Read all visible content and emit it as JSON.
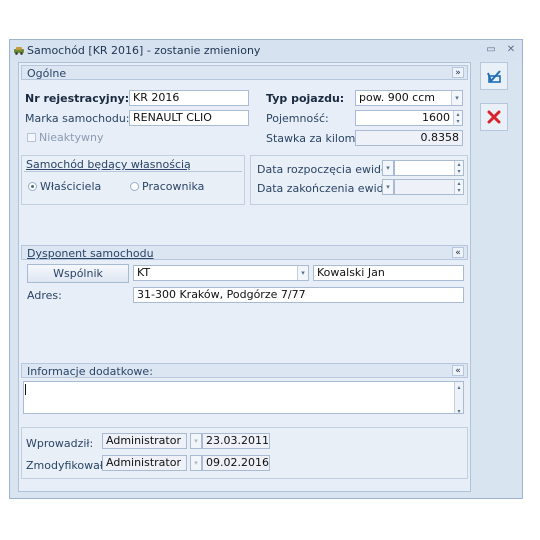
{
  "window": {
    "title": "Samochód [KR 2016] - zostanie zmieniony"
  },
  "general": {
    "section_title": "Ogólne",
    "reg_label": "Nr rejestracyjny:",
    "reg_value": "KR 2016",
    "brand_label": "Marka samochodu:",
    "brand_value": "RENAULT CLIO",
    "inactive_label": "Nieaktywny",
    "type_label": "Typ pojazdu:",
    "type_value": "pow. 900 ccm",
    "capacity_label": "Pojemność:",
    "capacity_value": "1600",
    "rate_label": "Stawka za kilometr:",
    "rate_value": "0.8358"
  },
  "ownership": {
    "title": "Samochód będący własnością",
    "option_owner": "Właściciela",
    "option_employee": "Pracownika",
    "selected": "Właściciela"
  },
  "records": {
    "start_label": "Data rozpoczęcia ewidencji:",
    "end_label": "Data zakończenia ewidencji:",
    "start_value": "",
    "end_value": ""
  },
  "dispatcher": {
    "section_title": "Dysponent samochodu",
    "type_button": "Wspólnik",
    "code_value": "KT",
    "name_value": "Kowalski Jan",
    "address_label": "Adres:",
    "address_value": "31-300 Kraków, Podgórze 7/77"
  },
  "extra": {
    "section_title": "Informacje dodatkowe:",
    "value": ""
  },
  "audit": {
    "entered_label": "Wprowadził:",
    "entered_user": "Administrator",
    "entered_date": "23.03.2011",
    "modified_label": "Zmodyfikował:",
    "modified_user": "Administrator",
    "modified_date": "09.02.2016"
  },
  "icons": {
    "save": "save-icon",
    "cancel": "cancel-icon",
    "collapse": "chevron-double-icon"
  },
  "colors": {
    "accent": "#1f6fb8",
    "cancel": "#d8232a",
    "chrome": "#d9e4f1"
  }
}
